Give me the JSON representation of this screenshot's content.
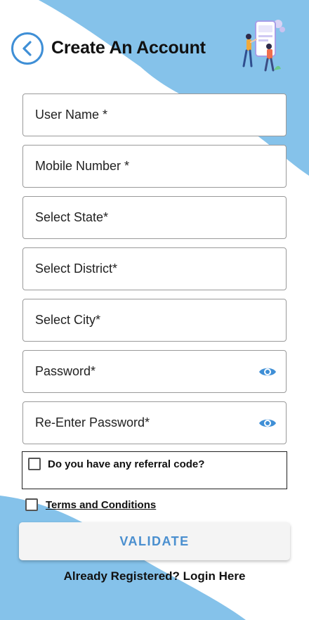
{
  "header": {
    "title": "Create An Account"
  },
  "form": {
    "fields": [
      {
        "label": "User Name *"
      },
      {
        "label": "Mobile Number *"
      },
      {
        "label": "Select State*"
      },
      {
        "label": "Select District*"
      },
      {
        "label": "Select City*"
      },
      {
        "label": "Password*",
        "icon": "eye-icon"
      },
      {
        "label": "Re-Enter Password*",
        "icon": "eye-icon"
      }
    ],
    "referral_label": "Do you have any referral code?",
    "terms_label": "Terms and Conditions",
    "validate_label": "VALIDATE",
    "login_label": "Already Registered? Login Here"
  },
  "colors": {
    "accent": "#3f8fd6",
    "background_wave": "#85c2ea",
    "button_text": "#4a8fcf"
  }
}
